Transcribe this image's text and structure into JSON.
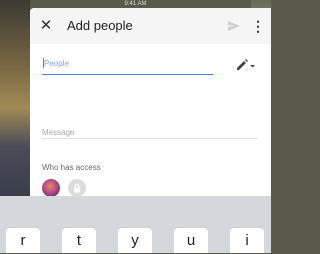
{
  "status_bar": {
    "time": "9:41 AM"
  },
  "dialog": {
    "close_icon": "close-icon",
    "title": "Add people",
    "send_icon": "send-icon",
    "more_icon": "more-vert-icon"
  },
  "people": {
    "placeholder": "People",
    "value": ""
  },
  "edit_icon": "pencil-dropdown-icon",
  "message": {
    "placeholder": "Message",
    "value": ""
  },
  "access": {
    "label": "Who has access",
    "owner_icon": "avatar",
    "lock_icon": "lock-icon"
  },
  "keyboard": {
    "keys": [
      "r",
      "t",
      "y",
      "u",
      "i"
    ]
  },
  "colors": {
    "accent": "#4285f4",
    "keyboard_bg": "#d4d7dc",
    "topbar": "#f5f5f5"
  }
}
